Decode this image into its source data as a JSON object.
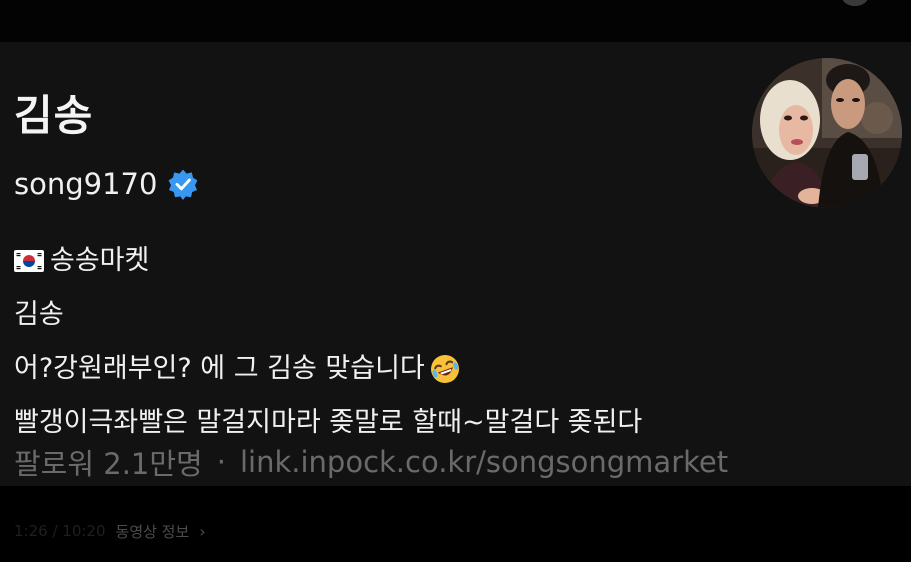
{
  "profile": {
    "display_name": "김송",
    "username": "song9170",
    "verified": true,
    "bio": {
      "line1": "송송마켓",
      "line2": "김송",
      "line3": "어?강원래부인? 에 그 김송 맞습니다",
      "line4": "빨갱이극좌빨은 말걸지마라 좆말로 할때~말걸다 좆된다"
    },
    "followers": "팔로워 2.1만명",
    "separator": "·",
    "link": "link.inpock.co.kr/songsongmarket"
  },
  "video_bar": {
    "timecode": "1:26 / 10:20",
    "info_label": "동영상 정보"
  },
  "icons": {
    "verified": "verified-check-icon",
    "flag": "korea-flag-icon",
    "emoji": "rolling-laughing-emoji-icon",
    "chevron": "chevron-right-icon"
  },
  "colors": {
    "card_background": "#121212",
    "page_background": "#000000",
    "verified_blue": "#3897f0",
    "muted_text": "#6a6a6a"
  }
}
